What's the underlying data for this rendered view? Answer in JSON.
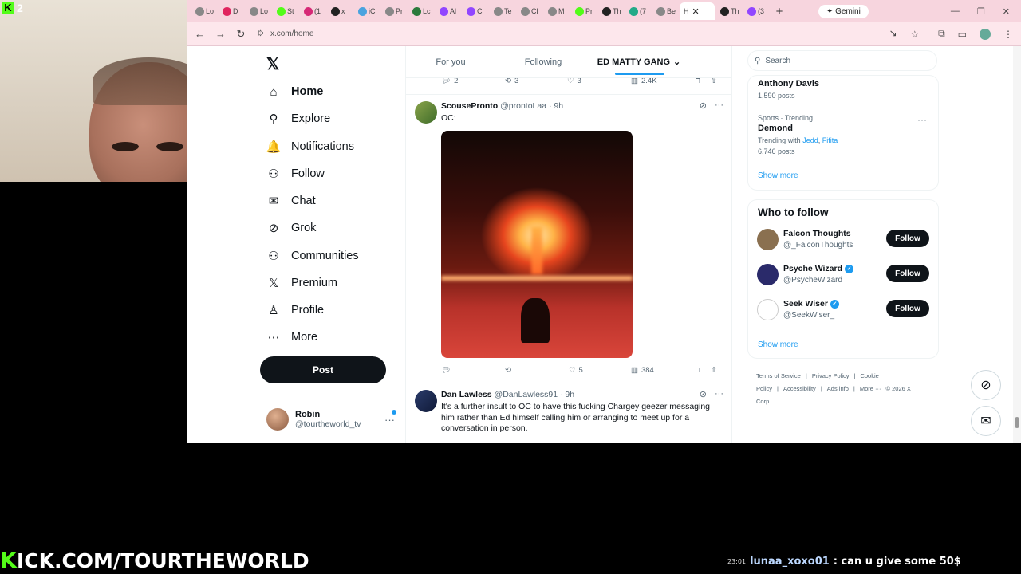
{
  "stream": {
    "badge_number": "2",
    "kick_letter": "K",
    "kick_url_rest": "ICK.COM/TOURTHEWORLD",
    "chat": {
      "time": "23:01",
      "user": "lunaa_xoxo01",
      "message": ": can u give some 50$"
    }
  },
  "browser": {
    "tabs": [
      {
        "label": "Lo",
        "color": "#888"
      },
      {
        "label": "D",
        "color": "#e0245e"
      },
      {
        "label": "Lo",
        "color": "#888"
      },
      {
        "label": "St",
        "color": "#53fc18"
      },
      {
        "label": "(1",
        "color": "#d62976"
      },
      {
        "label": "x",
        "color": "#222"
      },
      {
        "label": "iC",
        "color": "#4aa3df"
      },
      {
        "label": "Pr",
        "color": "#888"
      },
      {
        "label": "Lc",
        "color": "#2b7a3b"
      },
      {
        "label": "Al",
        "color": "#9146ff"
      },
      {
        "label": "Cl",
        "color": "#9146ff"
      },
      {
        "label": "Te",
        "color": "#888"
      },
      {
        "label": "Cl",
        "color": "#888"
      },
      {
        "label": "M",
        "color": "#888"
      },
      {
        "label": "Pr",
        "color": "#53fc18"
      },
      {
        "label": "Th",
        "color": "#222"
      },
      {
        "label": "(7",
        "color": "#2a8"
      },
      {
        "label": "Be",
        "color": "#888"
      }
    ],
    "active_tab": "H",
    "extra_tabs": [
      {
        "label": "Th",
        "color": "#222"
      },
      {
        "label": "(3",
        "color": "#9146ff"
      }
    ],
    "gemini_label": "✦ Gemini",
    "url": "x.com/home"
  },
  "nav": {
    "items": [
      {
        "label": "Home",
        "icon": "home-icon",
        "glyph": "⌂"
      },
      {
        "label": "Explore",
        "icon": "search-icon",
        "glyph": "⚲"
      },
      {
        "label": "Notifications",
        "icon": "bell-icon",
        "glyph": "🔔"
      },
      {
        "label": "Follow",
        "icon": "person-add-icon",
        "glyph": "⚇"
      },
      {
        "label": "Chat",
        "icon": "mail-icon",
        "glyph": "✉"
      },
      {
        "label": "Grok",
        "icon": "grok-icon",
        "glyph": "⊘"
      },
      {
        "label": "Communities",
        "icon": "communities-icon",
        "glyph": "⚇"
      },
      {
        "label": "Premium",
        "icon": "x-premium-icon",
        "glyph": "𝕏"
      },
      {
        "label": "Profile",
        "icon": "person-icon",
        "glyph": "♙"
      },
      {
        "label": "More",
        "icon": "more-circle-icon",
        "glyph": "⋯"
      }
    ],
    "post_label": "Post",
    "user_name": "Robin",
    "user_handle": "@tourtheworld_tv"
  },
  "timeline": {
    "tabs": [
      "For you",
      "Following",
      "ED MATTY GANG"
    ],
    "top_actions": {
      "replies": "2",
      "reposts": "3",
      "likes": "3",
      "views": "2.4K"
    },
    "tweet1": {
      "name": "ScousePronto",
      "meta": "@prontoLaa · 9h",
      "text": "OC:",
      "actions": {
        "replies": "",
        "reposts": "",
        "likes": "5",
        "views": "384"
      }
    },
    "tweet2": {
      "name": "Dan Lawless",
      "meta": "@DanLawless91 · 9h",
      "text": "It's a further insult to OC to have this fucking Chargey geezer messaging him rather than Ed himself calling him or arranging to meet up for a conversation in person."
    }
  },
  "right": {
    "search_placeholder": "Search",
    "trend_top": {
      "name": "Anthony Davis",
      "posts": "1,590 posts"
    },
    "trend2": {
      "category": "Sports · Trending",
      "name": "Demond",
      "with_prefix": "Trending with ",
      "with1": "Jedd",
      "with_sep": ", ",
      "with2": "Fifita",
      "posts": "6,746 posts"
    },
    "show_more": "Show more",
    "who_to_follow": "Who to follow",
    "people": [
      {
        "name": "Falcon Thoughts",
        "handle": "@_FalconThoughts",
        "verified": false,
        "color": "#8a7050"
      },
      {
        "name": "Psyche Wizard",
        "handle": "@PsycheWizard",
        "verified": true,
        "color": "#2a2a6a"
      },
      {
        "name": "Seek Wiser",
        "handle": "@SeekWiser_",
        "verified": true,
        "color": "#ffffff"
      }
    ],
    "follow_label": "Follow",
    "show_more2": "Show more",
    "footer": [
      "Terms of Service",
      "|",
      "Privacy Policy",
      "|",
      "Cookie Policy",
      "|",
      "Accessibility",
      "|",
      "Ads info",
      "|",
      "More ···",
      "© 2026 X Corp."
    ]
  }
}
